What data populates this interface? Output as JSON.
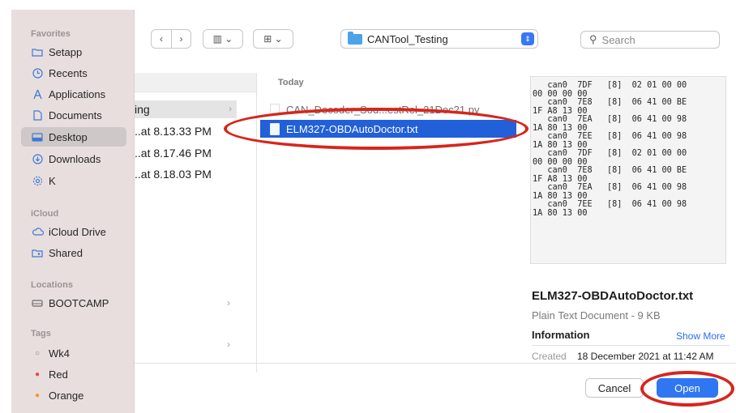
{
  "colors": {
    "accent": "#2f76f3",
    "annotation": "#d6261c",
    "selection": "#2160d8"
  },
  "sidebar": {
    "favorites_heading": "Favorites",
    "favorites": [
      {
        "label": "Setapp",
        "icon": "folder-icon"
      },
      {
        "label": "Recents",
        "icon": "clock-icon"
      },
      {
        "label": "Applications",
        "icon": "applications-icon"
      },
      {
        "label": "Documents",
        "icon": "document-icon"
      },
      {
        "label": "Desktop",
        "icon": "desktop-icon",
        "selected": true
      },
      {
        "label": "Downloads",
        "icon": "download-icon"
      },
      {
        "label": "K",
        "icon": "gear-icon"
      }
    ],
    "icloud_heading": "iCloud",
    "icloud": [
      {
        "label": "iCloud Drive",
        "icon": "cloud-icon"
      },
      {
        "label": "Shared",
        "icon": "shared-folder-icon"
      }
    ],
    "locations_heading": "Locations",
    "locations": [
      {
        "label": "BOOTCAMP",
        "icon": "drive-icon"
      }
    ],
    "tags_heading": "Tags",
    "tags": [
      {
        "label": "Wk4",
        "icon": "tag-empty-icon"
      },
      {
        "label": "Red",
        "icon": "tag-red-icon"
      },
      {
        "label": "Orange",
        "icon": "tag-orange-icon"
      }
    ]
  },
  "toolbar": {
    "back": "‹",
    "forward": "›",
    "view_columns": "▥ ⌄",
    "view_grid": "⊞ ⌄",
    "path_label": "CANTool_Testing",
    "search_placeholder": "Search"
  },
  "column1": {
    "rows": [
      {
        "label": "ing",
        "selected": true,
        "chevron": "›"
      },
      {
        "label": "..at 8.13.33 PM"
      },
      {
        "label": "..at 8.17.46 PM"
      },
      {
        "label": "..at 8.18.03 PM"
      }
    ],
    "sidebar_chevrons": [
      "›",
      "›"
    ]
  },
  "column2": {
    "header": "Today",
    "files": [
      {
        "label": "CAN_Decoder_Sou...estRel_21Dec21.py",
        "dim": true
      },
      {
        "label": "ELM327-OBDAutoDoctor.txt",
        "selected": true
      }
    ]
  },
  "preview": {
    "content": "   can0  7DF   [8]  02 01 00 00\n00 00 00 00\n   can0  7E8   [8]  06 41 00 BE\n1F A8 13 00\n   can0  7EA   [8]  06 41 00 98\n1A 80 13 00\n   can0  7EE   [8]  06 41 00 98\n1A 80 13 00\n   can0  7DF   [8]  02 01 00 00\n00 00 00 00\n   can0  7E8   [8]  06 41 00 BE\n1F A8 13 00\n   can0  7EA   [8]  06 41 00 98\n1A 80 13 00\n   can0  7EE   [8]  06 41 00 98\n1A 80 13 00",
    "file_name": "ELM327-OBDAutoDoctor.txt",
    "file_kind": "Plain Text Document - 9 KB",
    "information_label": "Information",
    "show_more_label": "Show More",
    "created_label": "Created",
    "created_value": "18 December 2021 at 11:42 AM"
  },
  "buttons": {
    "cancel": "Cancel",
    "open": "Open"
  }
}
